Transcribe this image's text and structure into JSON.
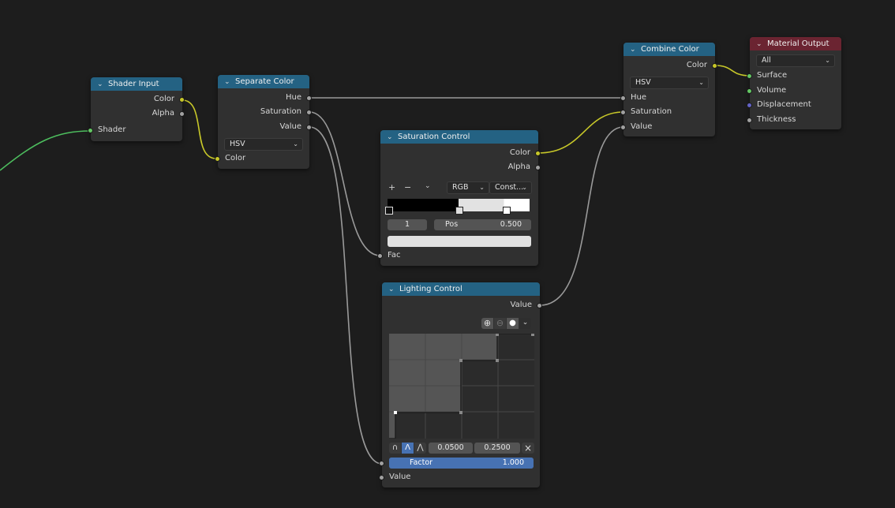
{
  "colors": {
    "canvas": "#1d1d1d",
    "node_body": "#303030",
    "header_blue": "#246283",
    "header_output": "#6b2431",
    "socket_color": "#c7c729",
    "socket_shader": "#63c763",
    "socket_float": "#a1a1a1",
    "socket_vector": "#6363c7",
    "wire_shader": "#4dbe5e",
    "wire_color": "#c7c729",
    "wire_float": "#9a9a9a",
    "factor_bar": "#4772b3"
  },
  "nodes": {
    "shader_input": {
      "title": "Shader Input",
      "outputs": [
        "Color",
        "Alpha"
      ],
      "inputs": [
        "Shader"
      ]
    },
    "separate_color": {
      "title": "Separate Color",
      "outputs": [
        "Hue",
        "Saturation",
        "Value"
      ],
      "mode": "HSV",
      "inputs": [
        "Color"
      ]
    },
    "saturation_control": {
      "title": "Saturation Control",
      "outputs": [
        "Color",
        "Alpha"
      ],
      "add_icon": "+",
      "remove_icon": "−",
      "color_mode": "RGB",
      "interpolation": "Const...",
      "active_stop": "1",
      "pos_label": "Pos",
      "pos_value": "0.500",
      "inputs": [
        "Fac"
      ]
    },
    "lighting_control": {
      "title": "Lighting Control",
      "outputs": [
        "Value"
      ],
      "curve_min": "0.0500",
      "curve_max": "0.2500",
      "factor_label": "Factor",
      "factor_value": "1.000",
      "factor_fraction": 1.0,
      "inputs": [
        "Value"
      ]
    },
    "combine_color": {
      "title": "Combine Color",
      "outputs": [
        "Color"
      ],
      "mode": "HSV",
      "inputs": [
        "Hue",
        "Saturation",
        "Value"
      ]
    },
    "material_output": {
      "title": "Material Output",
      "target": "All",
      "inputs": [
        "Surface",
        "Volume",
        "Displacement",
        "Thickness"
      ]
    }
  },
  "icons": {
    "collapse": "chevron-down-icon",
    "zoom": "zoom-in-icon",
    "clip": "clipping-icon",
    "dot": "dot-icon",
    "clear": "close-icon"
  }
}
